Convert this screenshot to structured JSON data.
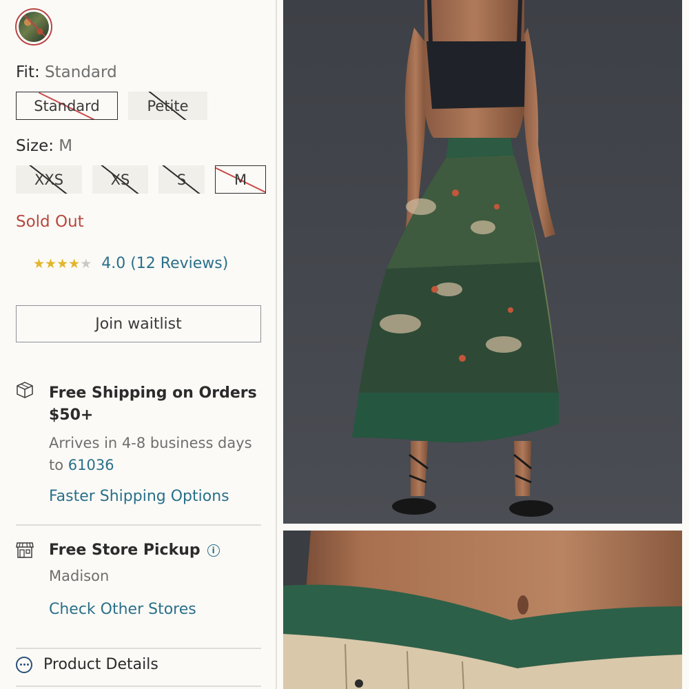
{
  "fit": {
    "label": "Fit:",
    "value": "Standard",
    "options": [
      {
        "label": "Standard",
        "selected": true
      },
      {
        "label": "Petite",
        "selected": false
      }
    ]
  },
  "size": {
    "label": "Size:",
    "value": "M",
    "options": [
      {
        "label": "XXS",
        "selected": false
      },
      {
        "label": "XS",
        "selected": false
      },
      {
        "label": "S",
        "selected": false
      },
      {
        "label": "M",
        "selected": true
      }
    ]
  },
  "availability": "Sold Out",
  "rating": {
    "stars": 4,
    "max_stars": 5,
    "text": "4.0 (12 Reviews)"
  },
  "waitlist_button": "Join waitlist",
  "shipping": {
    "title": "Free Shipping on Orders $50+",
    "arrives": "Arrives in 4-8 business days to",
    "zip": "61036",
    "link": "Faster Shipping Options",
    "icon": "package-icon"
  },
  "pickup": {
    "title": "Free Store Pickup",
    "store": "Madison",
    "link": "Check Other Stores",
    "icon": "store-icon"
  },
  "details": {
    "label": "Product Details",
    "icon": "more-dots-icon"
  },
  "colors": {
    "accent_link": "#2a6f8a",
    "sold_out": "#b8473f",
    "star": "#e2b52b",
    "selected_strike": "#c94a4a"
  }
}
